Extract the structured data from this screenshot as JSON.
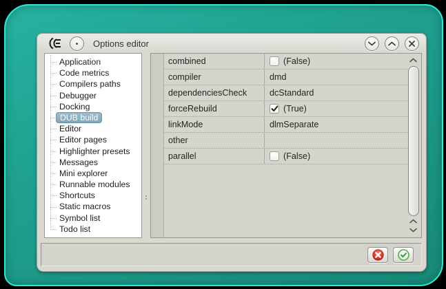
{
  "window": {
    "title": "Options editor",
    "controls": {
      "shade": "shade-window",
      "unshade": "unshade-window",
      "close": "close-window"
    }
  },
  "sidebar": {
    "items": [
      {
        "label": "Application"
      },
      {
        "label": "Code metrics"
      },
      {
        "label": "Compilers paths"
      },
      {
        "label": "Debugger"
      },
      {
        "label": "Docking"
      },
      {
        "label": "DUB build",
        "selected": true
      },
      {
        "label": "Editor"
      },
      {
        "label": "Editor pages"
      },
      {
        "label": "Highlighter presets"
      },
      {
        "label": "Messages"
      },
      {
        "label": "Mini explorer"
      },
      {
        "label": "Runnable modules"
      },
      {
        "label": "Shortcuts"
      },
      {
        "label": "Static macros"
      },
      {
        "label": "Symbol list"
      },
      {
        "label": "Todo list"
      }
    ]
  },
  "grid": {
    "rows": [
      {
        "name": "combined",
        "editor": "checkbox",
        "checked": false,
        "value": "(False)"
      },
      {
        "name": "compiler",
        "editor": "text",
        "value": "dmd"
      },
      {
        "name": "dependenciesCheck",
        "editor": "text",
        "value": "dcStandard"
      },
      {
        "name": "forceRebuild",
        "editor": "checkbox",
        "checked": true,
        "value": "(True)"
      },
      {
        "name": "linkMode",
        "editor": "text",
        "value": "dlmSeparate"
      },
      {
        "name": "other",
        "editor": "text",
        "value": ""
      },
      {
        "name": "parallel",
        "editor": "checkbox",
        "checked": false,
        "value": "(False)"
      }
    ]
  },
  "footer": {
    "cancel": "cancel-button",
    "accept": "accept-button"
  },
  "colors": {
    "frame_teal": "#1fa08e",
    "frame_rim_cyan": "#31e9d1",
    "window_bg": "#dad9d1",
    "selection_blue": "#7ea6bb",
    "cancel_red": "#c52b1c",
    "accept_green": "#4ba54b"
  }
}
